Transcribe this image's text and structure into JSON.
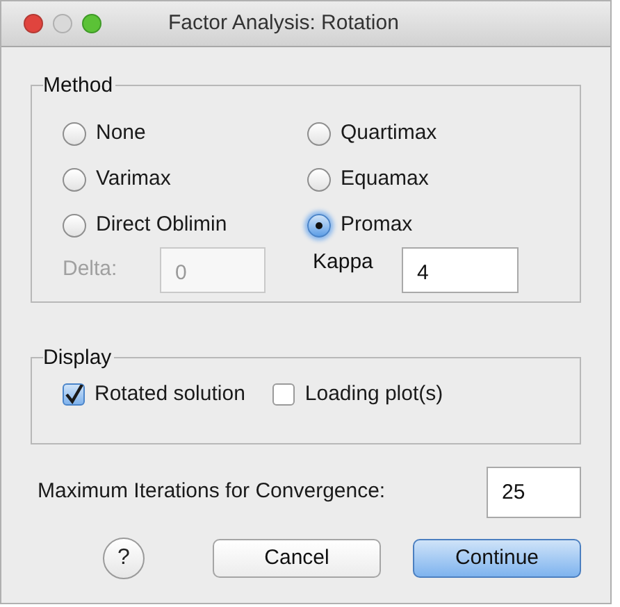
{
  "window": {
    "title": "Factor Analysis: Rotation"
  },
  "method": {
    "title": "Method",
    "options": [
      {
        "label": "None",
        "selected": false
      },
      {
        "label": "Quartimax",
        "selected": false
      },
      {
        "label": "Varimax",
        "selected": false
      },
      {
        "label": "Equamax",
        "selected": false
      },
      {
        "label": "Direct Oblimin",
        "selected": false
      },
      {
        "label": "Promax",
        "selected": true
      }
    ],
    "delta": {
      "label": "Delta:",
      "value": "0",
      "disabled": true
    },
    "kappa": {
      "label": "Kappa",
      "value": "4",
      "disabled": false
    }
  },
  "display": {
    "title": "Display",
    "options": [
      {
        "label": "Rotated solution",
        "checked": true
      },
      {
        "label": "Loading plot(s)",
        "checked": false
      }
    ]
  },
  "iterations": {
    "label": "Maximum Iterations for Convergence:",
    "value": "25"
  },
  "help": {
    "label": "?"
  },
  "buttons": [
    {
      "label": "Cancel",
      "default": false
    },
    {
      "label": "Continue",
      "default": true
    }
  ]
}
